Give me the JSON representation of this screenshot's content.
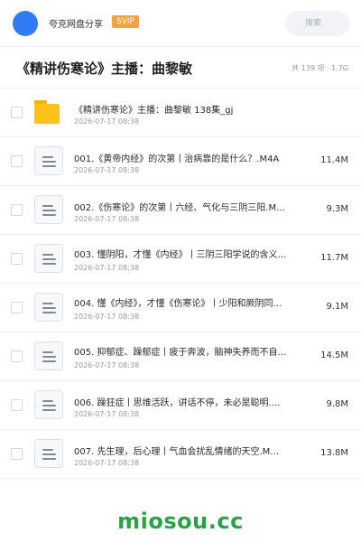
{
  "header": {
    "brand": "夸克网盘分享",
    "badge": "SVIP",
    "search_placeholder": "搜索"
  },
  "title_bar": {
    "title": "《精讲伤寒论》主播：曲黎敏",
    "meta": "共 139 项 · 1.7G"
  },
  "files": [
    {
      "type": "folder",
      "name": "《精讲伤寒论》主播：曲黎敏 138集_gj",
      "date": "2026-07-17 08:38",
      "size": ""
    },
    {
      "type": "file",
      "name": "001.《黄帝内经》的次第丨治病靠的是什么？.M4A",
      "date": "2026-07-17 08:38",
      "size": "11.4M"
    },
    {
      "type": "file",
      "name": "002.《伤寒论》的次第丨六经、气化与三阴三阳.M…",
      "date": "2026-07-17 08:38",
      "size": "9.3M"
    },
    {
      "type": "file",
      "name": "003. 懂阴阳，才懂《内经》丨三阴三阳学说的含义…",
      "date": "2026-07-17 08:38",
      "size": "11.7M"
    },
    {
      "type": "file",
      "name": "004. 懂《内经》，才懂《伤寒论》丨少阳和厥阴同…",
      "date": "2026-07-17 08:38",
      "size": "9.1M"
    },
    {
      "type": "file",
      "name": "005. 抑郁症、躁郁症丨疲于奔波，脑神失养而不自…",
      "date": "2026-07-17 08:38",
      "size": "14.5M"
    },
    {
      "type": "file",
      "name": "006. 躁狂症丨思维活跃，讲话不停，未必是聪明.…",
      "date": "2026-07-17 08:38",
      "size": "9.8M"
    },
    {
      "type": "file",
      "name": "007. 先生理，后心理丨气血会扰乱情绪的天空.M…",
      "date": "2026-07-17 08:38",
      "size": "13.8M"
    }
  ],
  "watermark": "miosou.cc",
  "colors": {
    "accent_blue": "#2f7cf6",
    "svip_orange": "#f7a23a",
    "folder_yellow": "#fcc21b",
    "watermark_green": "#2aa146"
  }
}
